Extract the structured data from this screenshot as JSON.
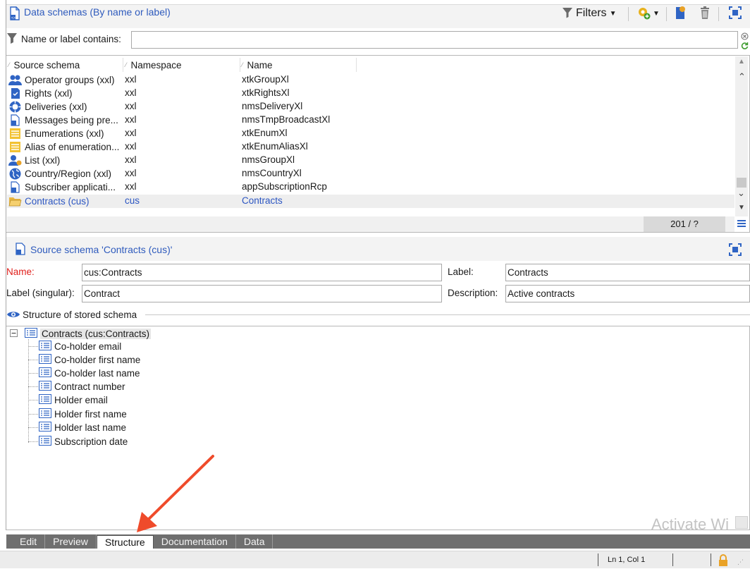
{
  "top_panel": {
    "title": "Data schemas (By name or label)",
    "filters_label": "Filters",
    "filter_label": "Name or label contains:",
    "filter_value": "",
    "columns": [
      "Source schema",
      "Namespace",
      "Name"
    ],
    "rows": [
      {
        "source": "Operator groups (xxl)",
        "namespace": "xxl",
        "name": "xtkGroupXl",
        "icon": "users-icon"
      },
      {
        "source": "Rights (xxl)",
        "namespace": "xxl",
        "name": "xtkRightsXl",
        "icon": "rights-icon"
      },
      {
        "source": "Deliveries (xxl)",
        "namespace": "xxl",
        "name": "nmsDeliveryXl",
        "icon": "delivery-icon"
      },
      {
        "source": "Messages being pre...",
        "namespace": "xxl",
        "name": "nmsTmpBroadcastXl",
        "icon": "schema-doc-icon"
      },
      {
        "source": "Enumerations (xxl)",
        "namespace": "xxl",
        "name": "xtkEnumXl",
        "icon": "enumeration-icon"
      },
      {
        "source": "Alias of enumeration...",
        "namespace": "xxl",
        "name": "xtkEnumAliasXl",
        "icon": "enumeration-icon"
      },
      {
        "source": "List (xxl)",
        "namespace": "xxl",
        "name": "nmsGroupXl",
        "icon": "list-group-icon"
      },
      {
        "source": "Country/Region (xxl)",
        "namespace": "xxl",
        "name": "nmsCountryXl",
        "icon": "globe-icon"
      },
      {
        "source": "Subscriber applicati...",
        "namespace": "xxl",
        "name": "appSubscriptionRcp",
        "icon": "schema-doc-icon"
      },
      {
        "source": "Contracts (cus)",
        "namespace": "cus",
        "name": "Contracts",
        "icon": "folder-icon",
        "selected": true
      }
    ],
    "count": "201 / ?"
  },
  "detail_panel": {
    "title": "Source schema 'Contracts (cus)'",
    "name_label": "Name:",
    "name_value": "cus:Contracts",
    "label_label": "Label:",
    "label_value": "Contracts",
    "singular_label": "Label (singular):",
    "singular_value": "Contract",
    "description_label": "Description:",
    "description_value": "Active contracts",
    "structure_title": "Structure of stored schema",
    "tree_root": "Contracts (cus:Contracts)",
    "tree_children": [
      "Co-holder email",
      "Co-holder first name",
      "Co-holder last name",
      "Contract number",
      "Holder email",
      "Holder first name",
      "Holder last name",
      "Subscription date"
    ]
  },
  "tabs": [
    "Edit",
    "Preview",
    "Structure",
    "Documentation",
    "Data"
  ],
  "active_tab": "Structure",
  "status": {
    "position": "Ln 1, Col 1"
  },
  "watermark": "Activate Wi",
  "colors": {
    "title_blue": "#2f5bbd",
    "required_red": "#e0201c",
    "annotation_arrow": "#ef4b2b"
  }
}
